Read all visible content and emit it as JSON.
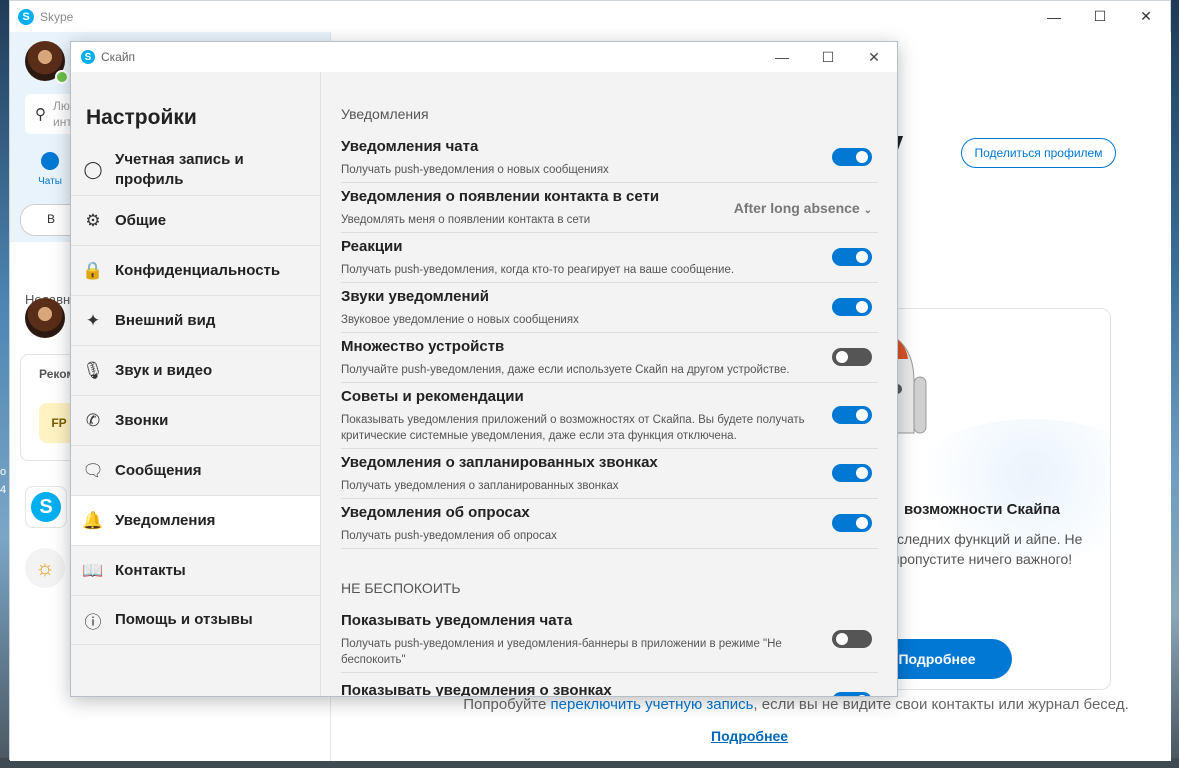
{
  "main": {
    "title": "Skype",
    "search_placeholder": "Лю инте",
    "chats_label": "Чаты",
    "meet_label": "В",
    "recent_label": "Недавн",
    "rec_card_title": "Реком",
    "fp_label": "FP",
    "big_letter": "v",
    "share_button": "Поделиться профилем",
    "promo_title": "возможности Скайпа",
    "promo_text": "последних функций и айпе. Не пропустите ничего важного!",
    "promo_button": "Подробнее",
    "bottom_note_prefix": "Попробуйте ",
    "bottom_note_link": "переключить учетную запись",
    "bottom_note_suffix": ", если вы не видите свои контакты или журнал бесед.",
    "more_link": "Подробнее"
  },
  "settings": {
    "window_title": "Скайп",
    "nav_title": "Настройки",
    "nav": [
      {
        "label": "Учетная запись и профиль",
        "icon": "person-icon"
      },
      {
        "label": "Общие",
        "icon": "gear-icon"
      },
      {
        "label": "Конфиденциальность",
        "icon": "lock-icon"
      },
      {
        "label": "Внешний вид",
        "icon": "magic-wand-icon"
      },
      {
        "label": "Звук и видео",
        "icon": "microphone-icon"
      },
      {
        "label": "Звонки",
        "icon": "phone-icon"
      },
      {
        "label": "Сообщения",
        "icon": "chat-bubble-icon"
      },
      {
        "label": "Уведомления",
        "icon": "bell-icon",
        "active": true
      },
      {
        "label": "Контакты",
        "icon": "contacts-book-icon"
      },
      {
        "label": "Помощь и отзывы",
        "icon": "info-icon"
      }
    ],
    "notifications_section": "Уведомления",
    "rows": [
      {
        "title": "Уведомления чата",
        "desc": "Получать push-уведомления о новых сообщениях",
        "state": "on"
      },
      {
        "title": "Уведомления о появлении контакта в сети",
        "desc": "Уведомлять меня о появлении контакта в сети",
        "dropdown": "After long absence"
      },
      {
        "title": "Реакции",
        "desc": "Получать push-уведомления, когда кто-то реагирует на ваше сообщение.",
        "state": "on"
      },
      {
        "title": "Звуки уведомлений",
        "desc": "Звуковое уведомление о новых сообщениях",
        "state": "on"
      },
      {
        "title": "Множество устройств",
        "desc": "Получайте push-уведомления, даже если используете Скайп на другом устройстве.",
        "state": "off"
      },
      {
        "title": "Советы и рекомендации",
        "desc": "Показывать уведомления приложений о возможностях от Скайпа. Вы будете получать критические системные уведомления, даже если эта функция отключена.",
        "state": "on"
      },
      {
        "title": "Уведомления о запланированных звонках",
        "desc": "Получать уведомления о запланированных звонках",
        "state": "on"
      },
      {
        "title": "Уведомления об опросах",
        "desc": "Получать push-уведомления об опросах",
        "state": "on"
      }
    ],
    "dnd_section": "НЕ БЕСПОКОИТЬ",
    "dnd_rows": [
      {
        "title": "Показывать уведомления чата",
        "desc": "Получать push-уведомления и уведомления-баннеры в приложении в режиме \"Не беспокоить\"",
        "state": "off"
      },
      {
        "title": "Показывать уведомления о звонках",
        "desc": "",
        "state": "on"
      }
    ]
  },
  "desktop": {
    "text1": "o",
    "text2": "4"
  }
}
